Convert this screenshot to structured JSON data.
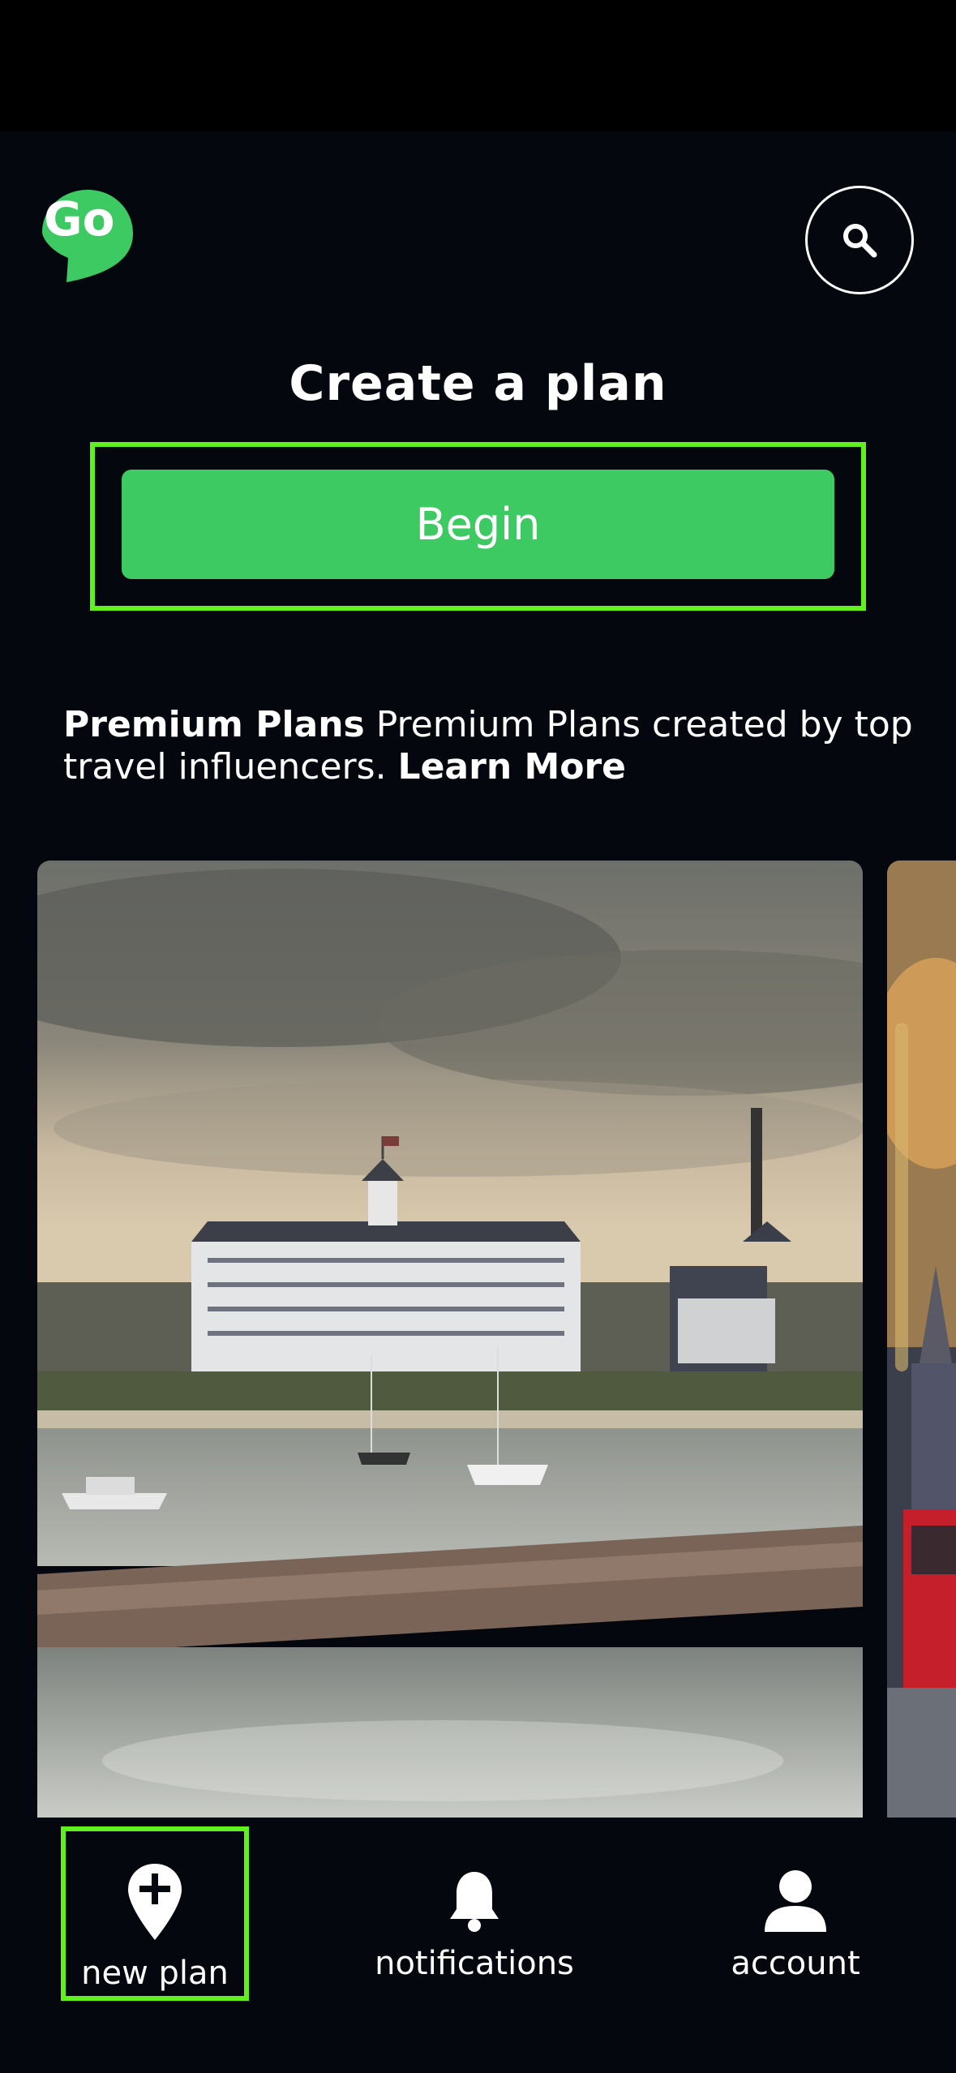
{
  "app": {
    "logo_text": "Go",
    "brand_color": "#3dca62",
    "highlight_color": "#5ff01e"
  },
  "header": {
    "search_icon": "search-icon"
  },
  "create_plan": {
    "title": "Create a plan",
    "begin_label": "Begin"
  },
  "premium": {
    "heading": "Premium Plans",
    "description": " Premium Plans created by top travel influencers. ",
    "learn_more": "Learn More"
  },
  "cards": [
    {
      "image": "harbor-hotel-photo"
    },
    {
      "image": "city-street-photo"
    }
  ],
  "bottom_nav": {
    "items": [
      {
        "label": "new plan",
        "icon": "map-pin-plus-icon"
      },
      {
        "label": "notifications",
        "icon": "bell-icon"
      },
      {
        "label": "account",
        "icon": "person-icon"
      }
    ]
  }
}
